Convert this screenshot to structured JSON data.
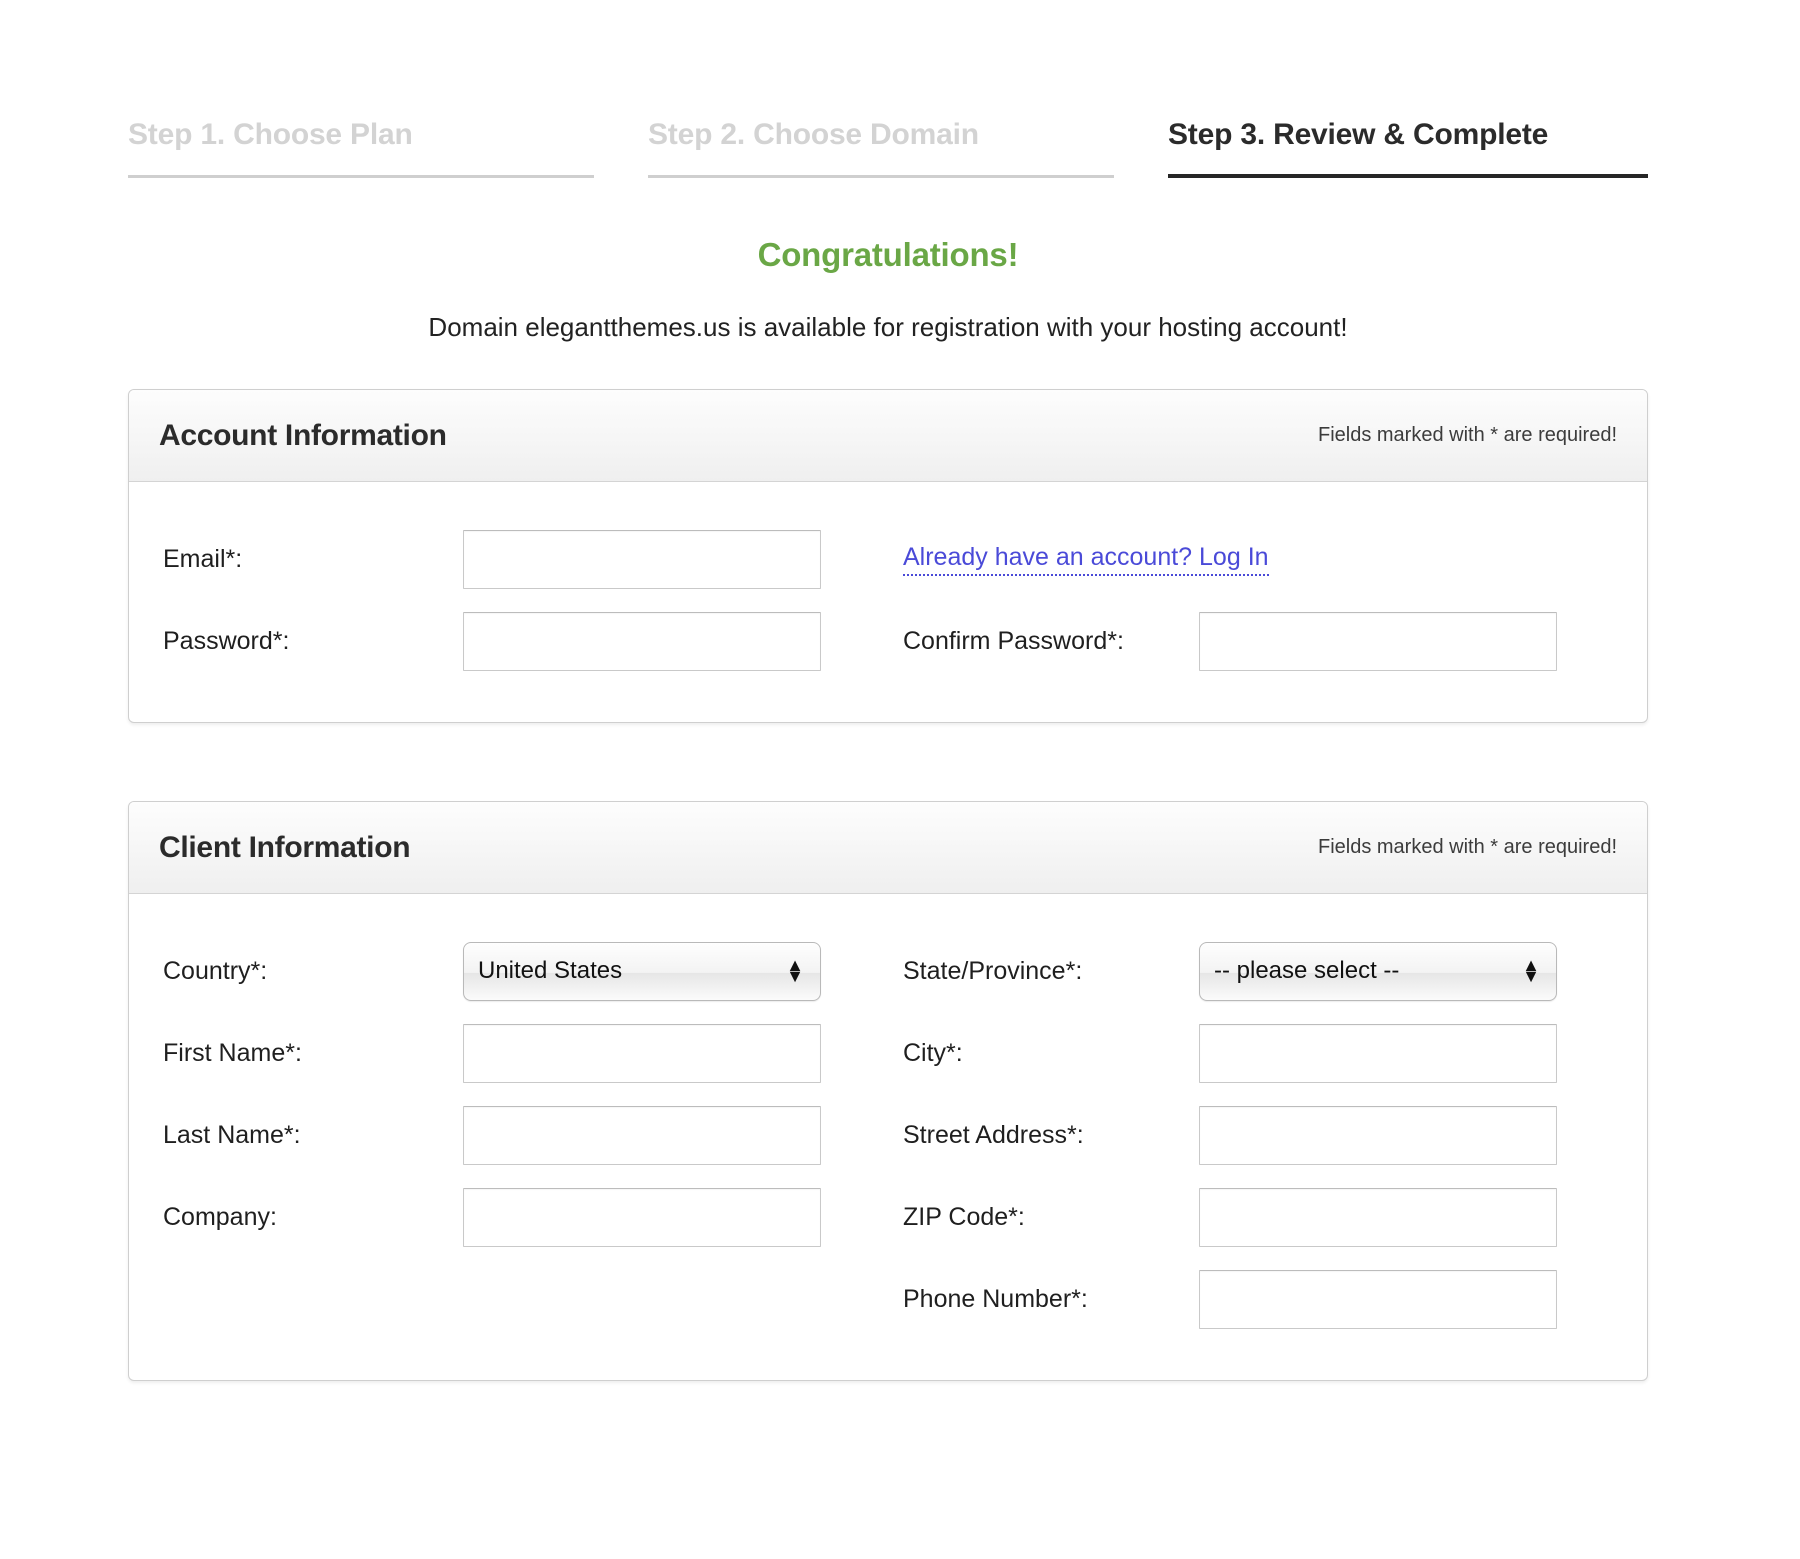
{
  "steps": [
    {
      "label": "Step 1. Choose Plan",
      "active": false
    },
    {
      "label": "Step 2. Choose Domain",
      "active": false
    },
    {
      "label": "Step 3. Review & Complete",
      "active": true
    }
  ],
  "headline": {
    "congrats": "Congratulations!",
    "message": "Domain elegantthemes.us is available for registration with your hosting account!",
    "congrats_color": "#6aa746"
  },
  "account_panel": {
    "title": "Account Information",
    "note": "Fields marked with * are required!",
    "email_label": "Email*:",
    "email_value": "",
    "login_link": "Already have an account? Log In",
    "password_label": "Password*:",
    "password_value": "",
    "confirm_password_label": "Confirm Password*:",
    "confirm_password_value": ""
  },
  "client_panel": {
    "title": "Client Information",
    "note": "Fields marked with * are required!",
    "country_label": "Country*:",
    "country_value": "United States",
    "state_label": "State/Province*:",
    "state_value": "-- please select --",
    "first_name_label": "First Name*:",
    "first_name_value": "",
    "city_label": "City*:",
    "city_value": "",
    "last_name_label": "Last Name*:",
    "last_name_value": "",
    "street_label": "Street Address*:",
    "street_value": "",
    "company_label": "Company:",
    "company_value": "",
    "zip_label": "ZIP Code*:",
    "zip_value": "",
    "phone_label": "Phone Number*:",
    "phone_value": "",
    "select_arrows": "select-stepper-icon"
  }
}
